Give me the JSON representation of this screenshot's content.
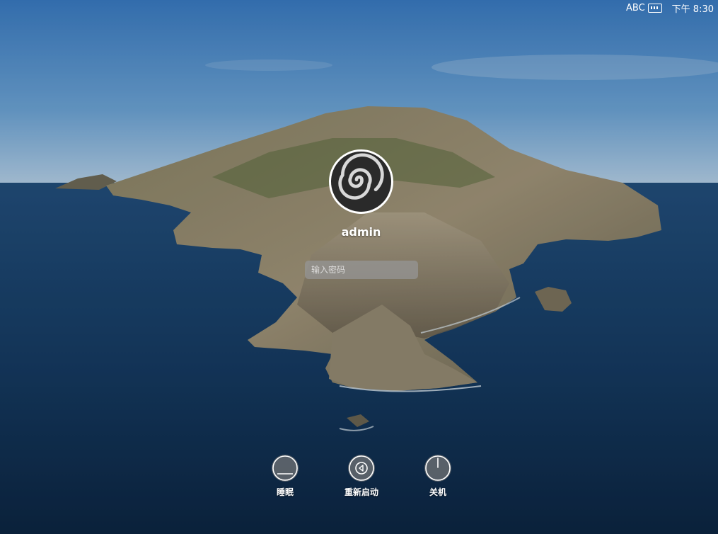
{
  "menubar": {
    "input_source": "ABC",
    "input_icon": "keyboard-icon",
    "clock": "下午 8:30"
  },
  "user": {
    "name": "admin",
    "avatar_icon": "swirl-avatar-icon"
  },
  "password": {
    "placeholder": "输入密码"
  },
  "controls": {
    "sleep": {
      "label": "睡眠",
      "icon": "sleep-icon"
    },
    "restart": {
      "label": "重新启动",
      "icon": "restart-icon"
    },
    "shutdown": {
      "label": "关机",
      "icon": "power-icon"
    }
  }
}
